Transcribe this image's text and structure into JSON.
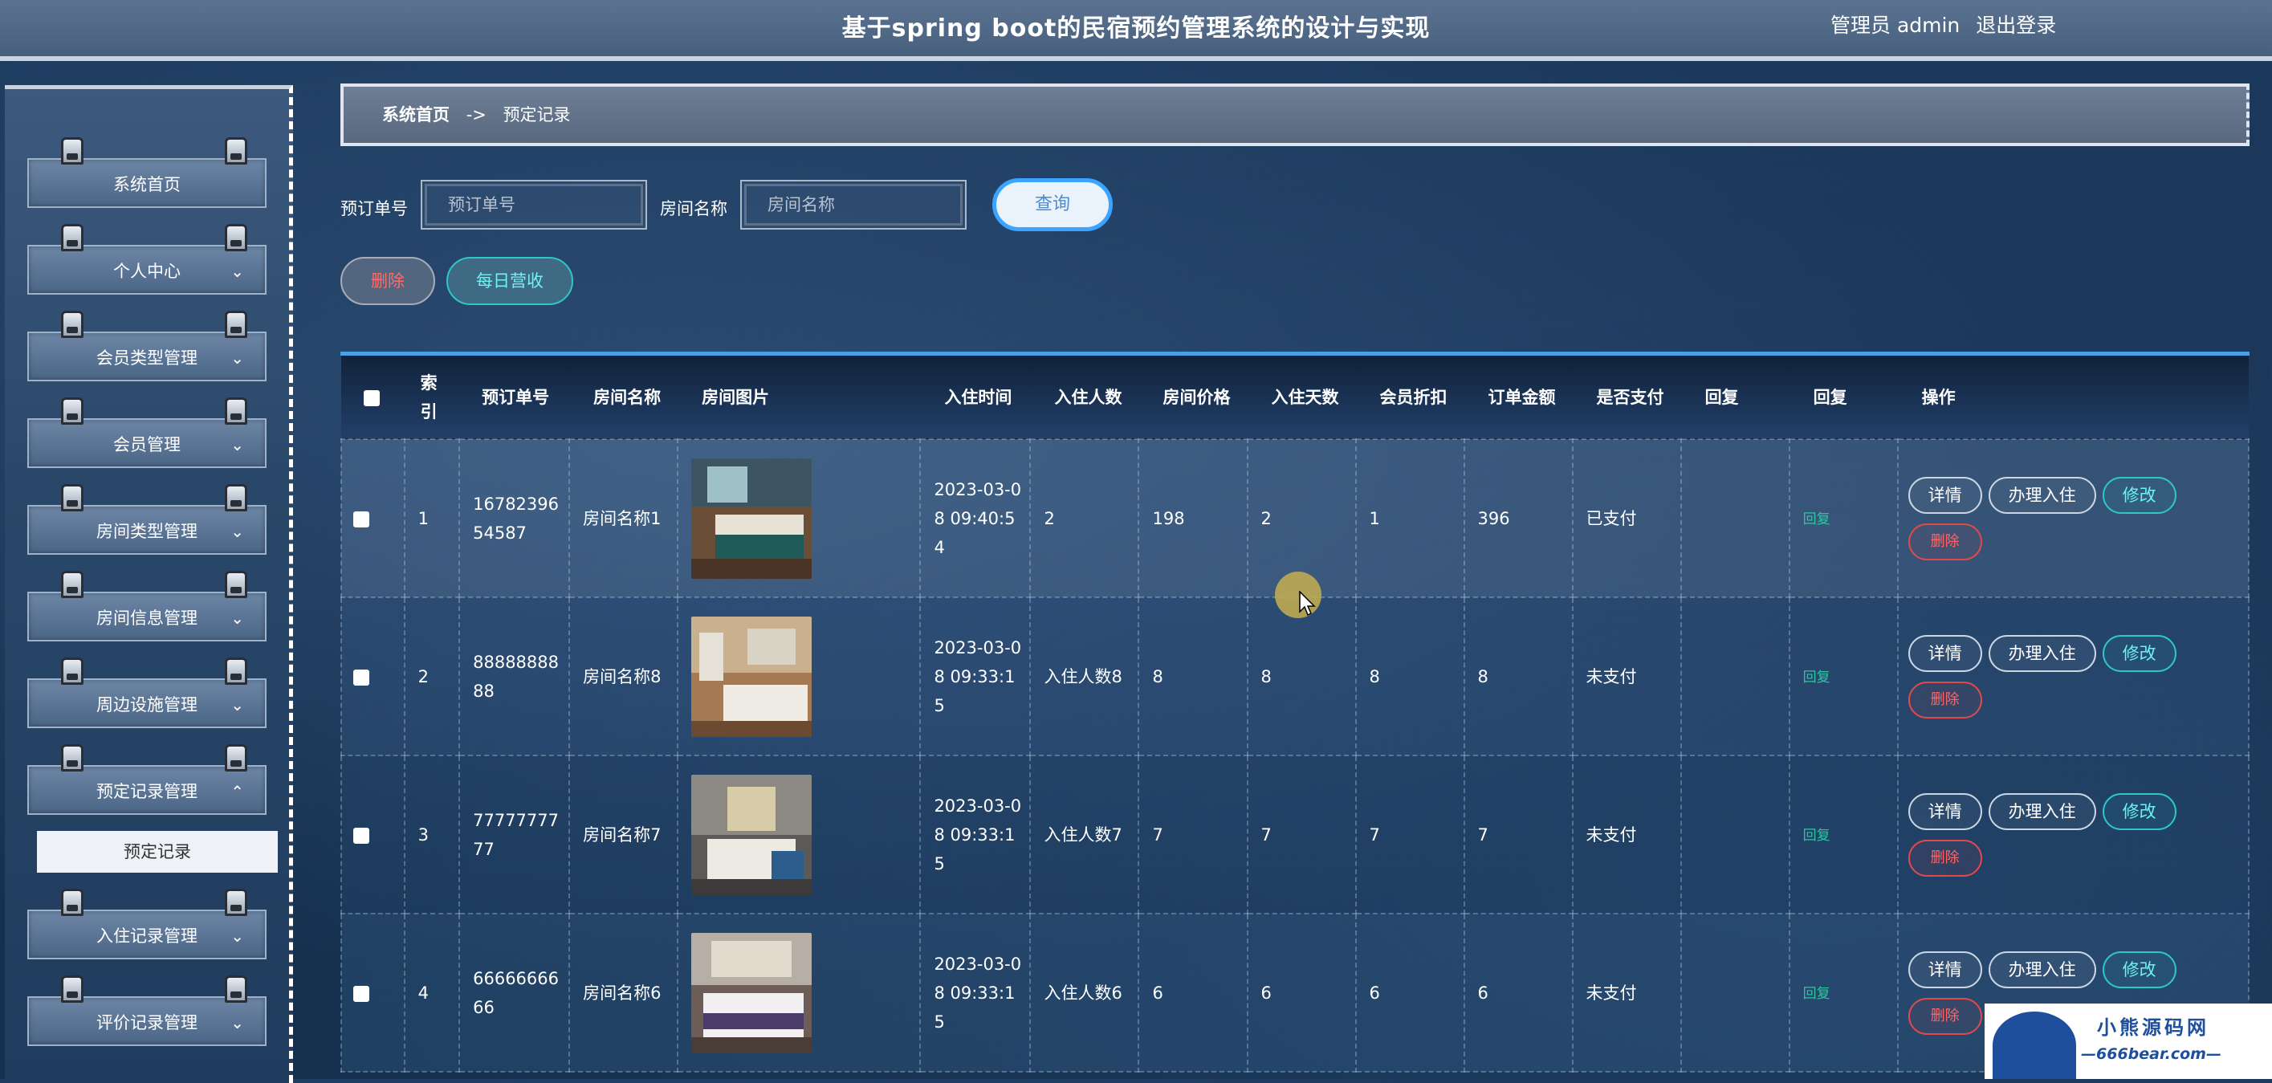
{
  "header": {
    "title": "基于spring boot的民宿预约管理系统的设计与实现",
    "user_label": "管理员 admin",
    "logout": "退出登录"
  },
  "sidebar": {
    "items": [
      {
        "label": "系统首页",
        "chevron": ""
      },
      {
        "label": "个人中心",
        "chevron": "⌄"
      },
      {
        "label": "会员类型管理",
        "chevron": "⌄"
      },
      {
        "label": "会员管理",
        "chevron": "⌄"
      },
      {
        "label": "房间类型管理",
        "chevron": "⌄"
      },
      {
        "label": "房间信息管理",
        "chevron": "⌄"
      },
      {
        "label": "周边设施管理",
        "chevron": "⌄"
      },
      {
        "label": "预定记录管理",
        "chevron": "⌃"
      },
      {
        "label": "入住记录管理",
        "chevron": "⌄"
      },
      {
        "label": "评价记录管理",
        "chevron": "⌄"
      }
    ],
    "submenu": {
      "label": "预定记录"
    }
  },
  "breadcrumb": {
    "home": "系统首页",
    "sep": "->",
    "current": "预定记录"
  },
  "search": {
    "order_label": "预订单号",
    "order_placeholder": "预订单号",
    "room_label": "房间名称",
    "room_placeholder": "房间名称",
    "query_button": "查询"
  },
  "actions": {
    "delete": "删除",
    "revenue": "每日营收"
  },
  "table": {
    "headers": [
      "索引",
      "预订单号",
      "房间名称",
      "房间图片",
      "入住时间",
      "入住人数",
      "房间价格",
      "入住天数",
      "会员折扣",
      "订单金额",
      "是否支付",
      "回复",
      "回复",
      "操作"
    ],
    "rows": [
      {
        "index": "1",
        "order_no": "1678239654587",
        "room": "房间名称1",
        "checkin_time": "2023-03-08 09:40:54",
        "people": "2",
        "price": "198",
        "days": "2",
        "discount": "1",
        "amount": "396",
        "paid": "已支付",
        "reply": "",
        "reply_link": "回复"
      },
      {
        "index": "2",
        "order_no": "8888888888",
        "room": "房间名称8",
        "checkin_time": "2023-03-08 09:33:15",
        "people": "入住人数8",
        "price": "8",
        "days": "8",
        "discount": "8",
        "amount": "8",
        "paid": "未支付",
        "reply": "",
        "reply_link": "回复"
      },
      {
        "index": "3",
        "order_no": "7777777777",
        "room": "房间名称7",
        "checkin_time": "2023-03-08 09:33:15",
        "people": "入住人数7",
        "price": "7",
        "days": "7",
        "discount": "7",
        "amount": "7",
        "paid": "未支付",
        "reply": "",
        "reply_link": "回复"
      },
      {
        "index": "4",
        "order_no": "6666666666",
        "room": "房间名称6",
        "checkin_time": "2023-03-08 09:33:15",
        "people": "入住人数6",
        "price": "6",
        "days": "6",
        "discount": "6",
        "amount": "6",
        "paid": "未支付",
        "reply": "",
        "reply_link": "回复"
      }
    ],
    "row_actions": {
      "detail": "详情",
      "checkin": "办理入住",
      "edit": "修改",
      "delete": "删除"
    }
  },
  "watermark": {
    "title": "小熊源码网",
    "url": "—666bear.com—"
  },
  "colors": {
    "accent": "#3aa4ff",
    "teal": "#2ec6c6",
    "danger": "#e04a4a"
  }
}
